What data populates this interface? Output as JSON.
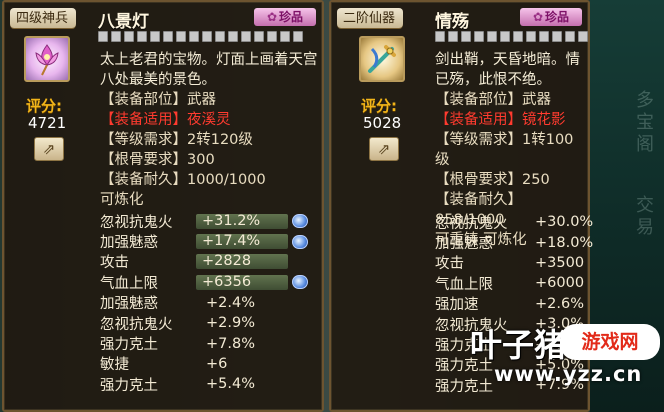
{
  "background": {
    "ghost_text": [
      "多宝阁",
      "交易"
    ]
  },
  "left": {
    "grade": "四级神兵",
    "name": "八景灯",
    "rarity": "珍品",
    "desc": "太上老君的宝物。灯面上画着天宫八处最美的景色。",
    "score_label": "评分:",
    "score": "4721",
    "info": [
      {
        "k": "【装备部位】",
        "v": "武器"
      },
      {
        "k": "【装备适用】",
        "v": "夜溪灵",
        "red": true
      },
      {
        "k": "【等级需求】",
        "v": "2转120级"
      },
      {
        "k": "【根骨要求】",
        "v": "300"
      },
      {
        "k": "【装备耐久】",
        "v": "1000/1000"
      }
    ],
    "refine": "可炼化",
    "stats": [
      {
        "k": "忽视抗鬼火",
        "v": "+31.2%",
        "bar": true,
        "orb": true
      },
      {
        "k": "加强魅惑",
        "v": "+17.4%",
        "bar": true,
        "orb": true
      },
      {
        "k": "攻击",
        "v": "+2828",
        "bar": true,
        "orb": false
      },
      {
        "k": "气血上限",
        "v": "+6356",
        "bar": true,
        "orb": true
      },
      {
        "k": "加强魅惑",
        "v": "+2.4%"
      },
      {
        "k": "忽视抗鬼火",
        "v": "+2.9%"
      },
      {
        "k": "强力克土",
        "v": "+7.8%"
      },
      {
        "k": "敏捷",
        "v": "+6"
      },
      {
        "k": "强力克土",
        "v": "+5.4%"
      }
    ]
  },
  "right": {
    "grade": "二阶仙器",
    "name": "情殇",
    "rarity": "珍品",
    "desc": "剑出鞘，天昏地暗。情已殇，此恨不绝。",
    "score_label": "评分:",
    "score": "5028",
    "info": [
      {
        "k": "【装备部位】",
        "v": "武器"
      },
      {
        "k": "【装备适用】",
        "v": "镜花影",
        "red": true
      },
      {
        "k": "【等级需求】",
        "v": "1转100级"
      },
      {
        "k": "【根骨要求】",
        "v": "250"
      },
      {
        "k": "【装备耐久】",
        "v": "858/1000"
      }
    ],
    "refine": "可重铸 可炼化",
    "stats": [
      {
        "k": "忽视抗鬼火",
        "v": "+30.0%"
      },
      {
        "k": "加强魅惑",
        "v": "+18.0%"
      },
      {
        "k": "攻击",
        "v": "+3500"
      },
      {
        "k": "气血上限",
        "v": "+6000"
      },
      {
        "k": "强加速",
        "v": "+2.6%"
      },
      {
        "k": "忽视抗鬼火",
        "v": "+3.0%"
      },
      {
        "k": "强力克土",
        "v": "+5.0%"
      },
      {
        "k": "强力克土",
        "v": "+5.0%"
      },
      {
        "k": "强力克土",
        "v": "+7.9%"
      }
    ]
  },
  "watermark": {
    "brand": "叶子猪",
    "badge": "游戏网",
    "url": "www.yzz.cn"
  }
}
